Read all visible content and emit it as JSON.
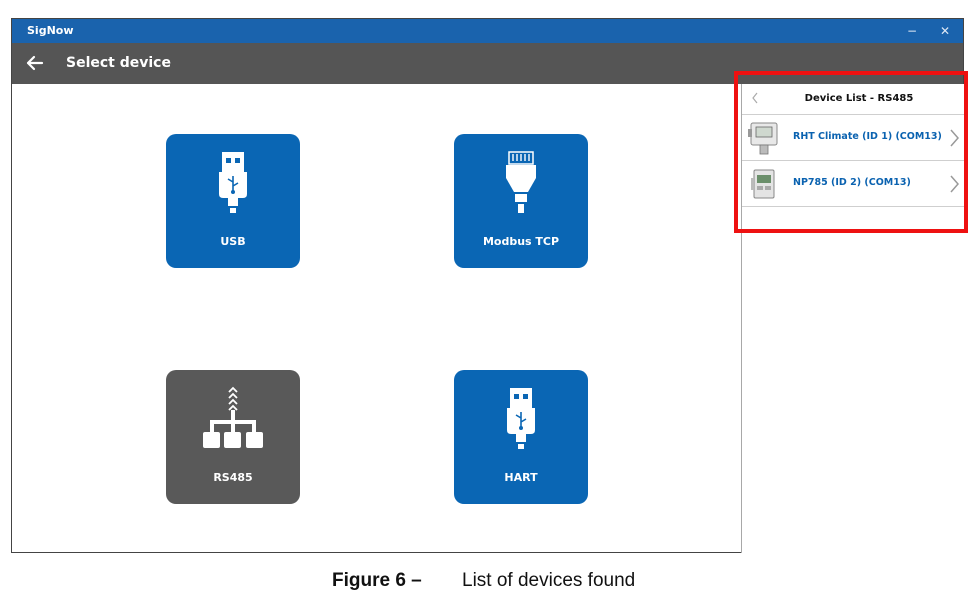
{
  "window": {
    "app_title": "SigNow",
    "minimize_glyph": "−",
    "close_glyph": "✕"
  },
  "header": {
    "back_icon": "arrow-left-icon",
    "title": "Select device"
  },
  "tiles": [
    {
      "label": "USB",
      "icon": "usb-icon",
      "color": "#0a66b4"
    },
    {
      "label": "Modbus TCP",
      "icon": "ethernet-plug-icon",
      "color": "#0a66b4"
    },
    {
      "label": "RS485",
      "icon": "network-tree-icon",
      "color": "#595959"
    },
    {
      "label": "HART",
      "icon": "usb-icon",
      "color": "#0a66b4"
    }
  ],
  "device_panel": {
    "title": "Device List - RS485",
    "devices": [
      {
        "name": "RHT Climate (ID 1) (COM13)"
      },
      {
        "name": "NP785 (ID 2) (COM13)"
      }
    ]
  },
  "caption": {
    "figure": "Figure 6 –",
    "text": "List of devices found"
  },
  "colors": {
    "titlebar": "#1a63ad",
    "header": "#555555",
    "accent_blue": "#0a66b4",
    "highlight_red": "#ee1111"
  }
}
